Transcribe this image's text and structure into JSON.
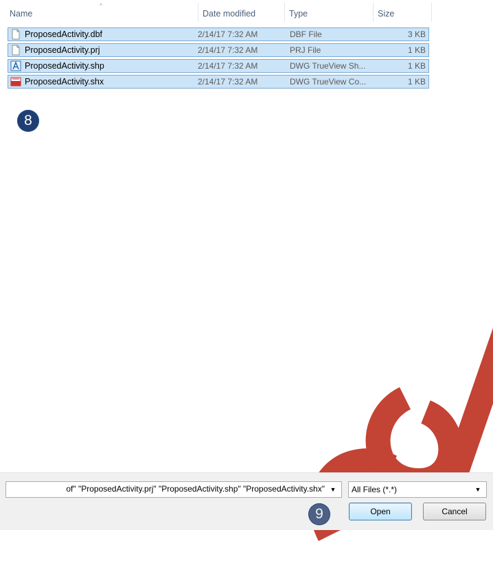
{
  "header": {
    "columns": {
      "name": "Name",
      "date": "Date modified",
      "type": "Type",
      "size": "Size"
    }
  },
  "files": [
    {
      "name": "ProposedActivity.dbf",
      "date": "2/14/17 7:32 AM",
      "type": "DBF File",
      "size": "3 KB",
      "icon": "generic-file-icon"
    },
    {
      "name": "ProposedActivity.prj",
      "date": "2/14/17 7:32 AM",
      "type": "PRJ File",
      "size": "1 KB",
      "icon": "generic-file-icon"
    },
    {
      "name": "ProposedActivity.shp",
      "date": "2/14/17 7:32 AM",
      "type": "DWG TrueView Sh...",
      "size": "1 KB",
      "icon": "dwg-trueview-shape-icon"
    },
    {
      "name": "ProposedActivity.shx",
      "date": "2/14/17 7:32 AM",
      "type": "DWG TrueView Co...",
      "size": "1 KB",
      "icon": "shx-file-icon"
    }
  ],
  "callouts": {
    "step_a": "8",
    "step_b": "9"
  },
  "bottom": {
    "filename_value": "of\" \"ProposedActivity.prj\" \"ProposedActivity.shp\" \"ProposedActivity.shx\"",
    "file_type_filter": "All Files (*.*)",
    "open_label": "Open",
    "cancel_label": "Cancel"
  },
  "colors": {
    "selection": "#cce4f7",
    "selection_border": "#7aa9d6",
    "callout": "#1f3f73",
    "watermark": "#c0392b"
  }
}
